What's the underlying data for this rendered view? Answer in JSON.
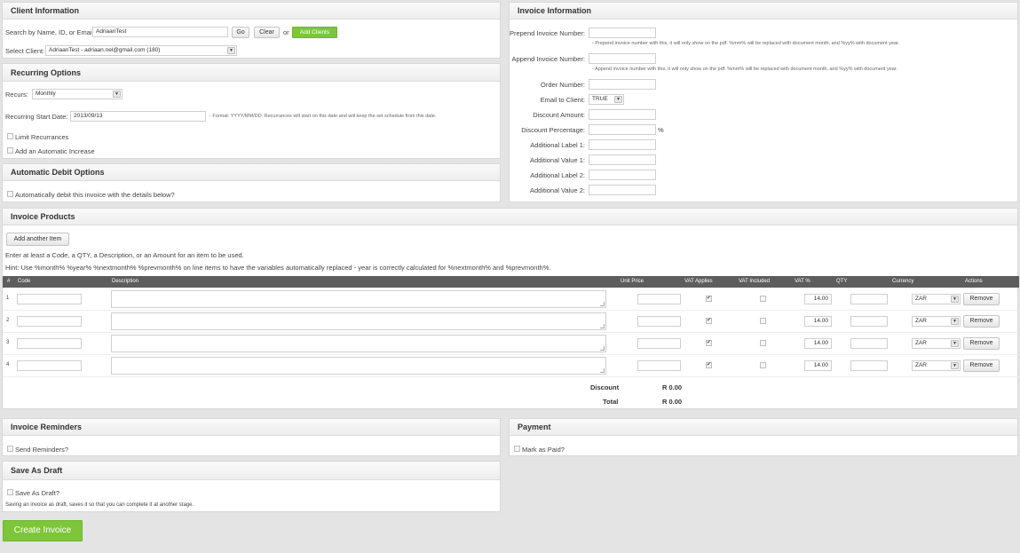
{
  "client": {
    "title": "Client Information",
    "search_label": "Search by Name, ID, or Email:",
    "search_value": "AdriaanTest",
    "go": "Go",
    "clear": "Clear",
    "or": "or",
    "add_clients": "Add Clients",
    "select_label": "Select Client:",
    "select_value": "AdriaanTest - adriaan.nel@gmail.com (180)"
  },
  "recurring": {
    "title": "Recurring Options",
    "recurs_label": "Recurs:",
    "recurs_value": "Monthly",
    "start_label": "Recurring Start Date:",
    "start_value": "2013/09/13",
    "start_hint": "- Format: YYYY/MM/DD. Recurrances will start on this date and will keep the set schedule from this date.",
    "limit_label": "Limit Recurrances",
    "increase_label": "Add an Automatic Increase"
  },
  "debit": {
    "title": "Automatic Debit Options",
    "auto_label": "Automatically debit this invoice with the details below?"
  },
  "invoice_info": {
    "title": "Invoice Information",
    "prepend_label": "Prepend Invoice Number:",
    "prepend_hint": "- Prepend invoice number with this, it will only show on the pdf. %mm% will be replaced with document month, and %yy% with document year.",
    "append_label": "Append Invoice Number:",
    "append_hint": "- Append invoice number with this, it will only show on the pdf. %mm% will be replaced with document month, and %yy% with document year.",
    "order_label": "Order Number:",
    "email_label": "Email to Client:",
    "email_value": "TRUE",
    "discount_amount_label": "Discount Amount:",
    "discount_pct_label": "Discount Percentage:",
    "pct_sign": "%",
    "label1": "Additional Label 1:",
    "value1": "Additional Value 1:",
    "label2": "Additional Label 2:",
    "value2": "Additional Value 2:"
  },
  "products": {
    "title": "Invoice Products",
    "add_item": "Add another Item",
    "note": "Enter at least a Code, a QTY, a Description, or an Amount for an item to be used.",
    "hint": "Hint: Use %month% %year% %nextmonth% %prevmonth% on line items to have the variables automatically replaced - year is correctly calculated for %nextmonth% and %prevmonth%.",
    "columns": [
      "#",
      "Code",
      "Description",
      "Unit Price",
      "VAT Applies",
      "VAT Included",
      "VAT %",
      "QTY",
      "Currency",
      "Actions"
    ],
    "rows": [
      {
        "num": "1",
        "vat_applies": true,
        "vat_included": false,
        "vat_pct": "14.00",
        "currency": "ZAR",
        "remove": "Remove"
      },
      {
        "num": "2",
        "vat_applies": true,
        "vat_included": false,
        "vat_pct": "14.00",
        "currency": "ZAR",
        "remove": "Remove"
      },
      {
        "num": "3",
        "vat_applies": true,
        "vat_included": false,
        "vat_pct": "14.00",
        "currency": "ZAR",
        "remove": "Remove"
      },
      {
        "num": "4",
        "vat_applies": true,
        "vat_included": false,
        "vat_pct": "14.00",
        "currency": "ZAR",
        "remove": "Remove"
      }
    ],
    "discount_label": "Discount",
    "discount_value": "R 0.00",
    "total_label": "Total",
    "total_value": "R 0.00"
  },
  "reminders": {
    "title": "Invoice Reminders",
    "send_label": "Send Reminders?"
  },
  "payment": {
    "title": "Payment",
    "paid_label": "Mark as Paid?"
  },
  "draft": {
    "title": "Save As Draft",
    "save_label": "Save As Draft?",
    "note": "Saving an invoice as draft, saves it so that you can complete it at another stage."
  },
  "create_button": "Create Invoice",
  "colors": {
    "accent_green": "#7dc63a",
    "table_header": "#5d5d5d",
    "page_bg": "#e4e4e4"
  }
}
